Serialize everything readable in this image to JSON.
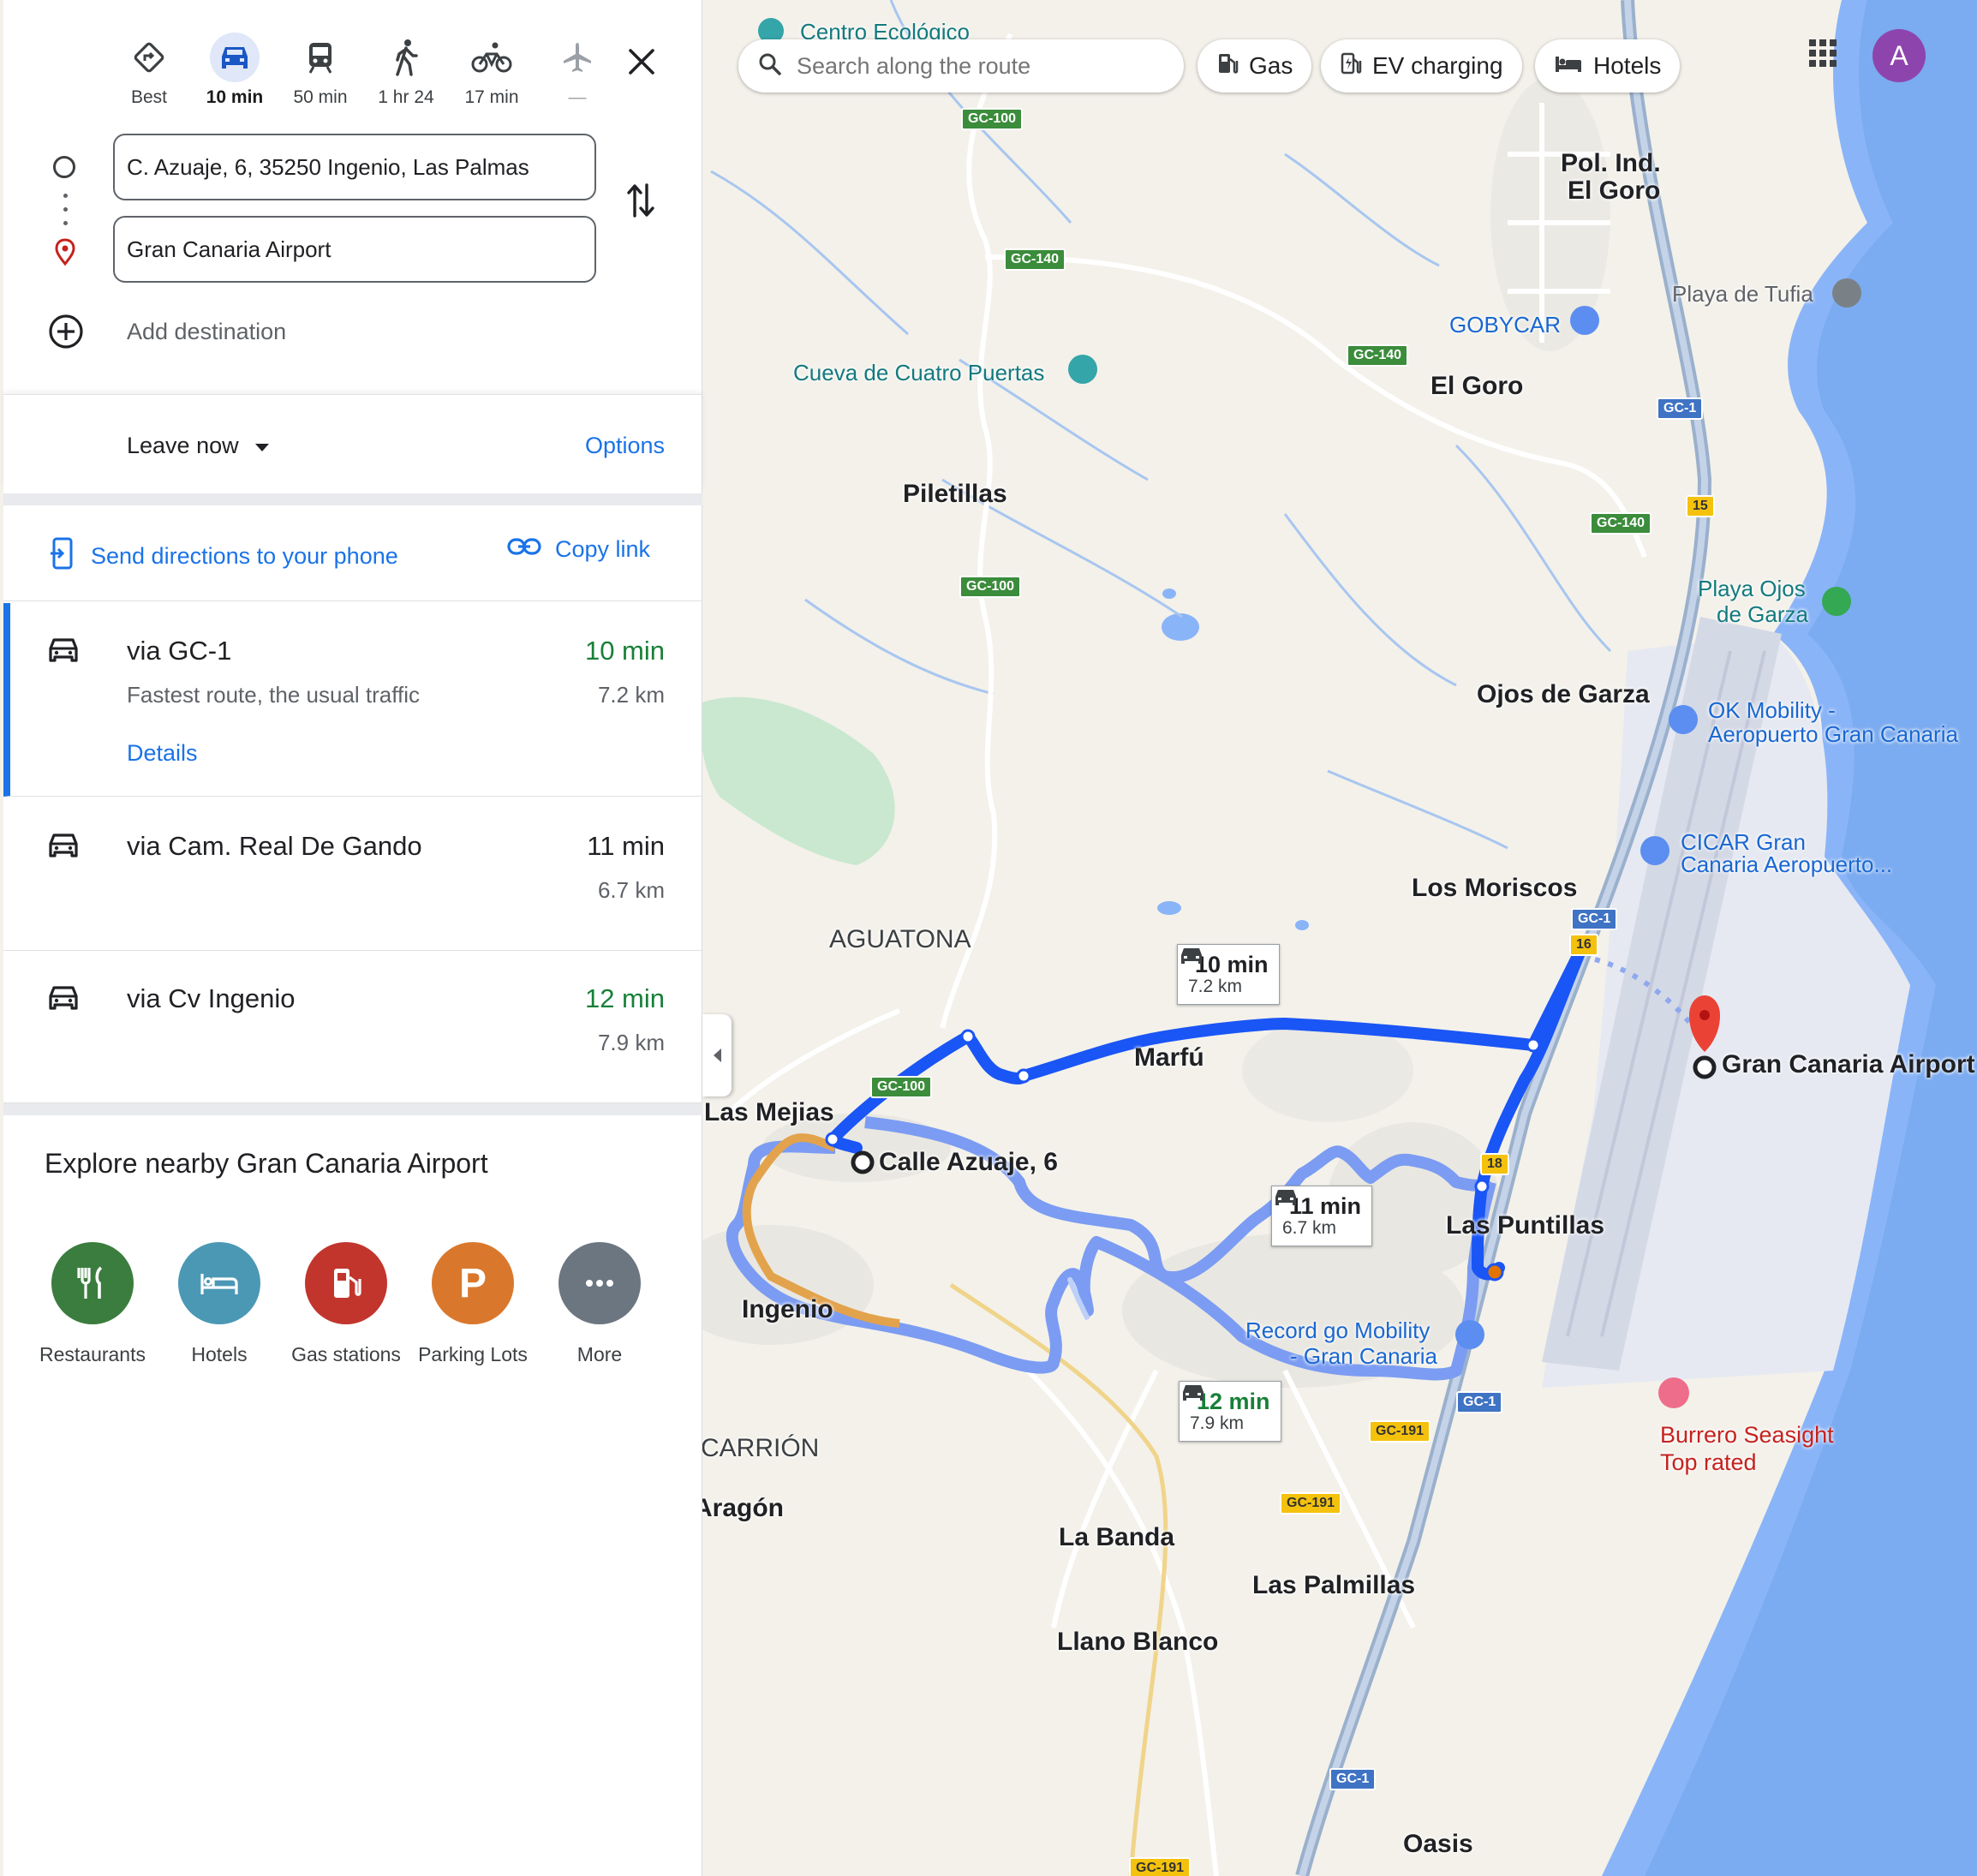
{
  "travel_modes": [
    {
      "name": "best",
      "label": "Best",
      "active": false
    },
    {
      "name": "driving",
      "label": "10 min",
      "active": true
    },
    {
      "name": "transit",
      "label": "50 min",
      "active": false
    },
    {
      "name": "walking",
      "label": "1 hr 24",
      "active": false
    },
    {
      "name": "cycling",
      "label": "17 min",
      "active": false
    },
    {
      "name": "flights",
      "label": "—",
      "active": false
    }
  ],
  "inputs": {
    "origin": "C. Azuaje, 6, 35250 Ingenio, Las Palmas",
    "destination": "Gran Canaria Airport",
    "add_destination": "Add destination"
  },
  "leave": {
    "label": "Leave now",
    "options": "Options"
  },
  "share": {
    "send_to_phone": "Send directions to your phone",
    "copy_link": "Copy link"
  },
  "routes": [
    {
      "name": "via GC-1",
      "subtitle": "Fastest route, the usual traffic",
      "time": "10 min",
      "distance": "7.2 km",
      "details": "Details",
      "time_color": "green"
    },
    {
      "name": "via Cam. Real De Gando",
      "subtitle": "",
      "time": "11 min",
      "distance": "6.7 km",
      "details": "",
      "time_color": "dark"
    },
    {
      "name": "via Cv Ingenio",
      "subtitle": "",
      "time": "12 min",
      "distance": "7.9 km",
      "details": "",
      "time_color": "green"
    }
  ],
  "explore": {
    "title": "Explore nearby Gran Canaria Airport",
    "categories": [
      {
        "name": "restaurants",
        "label": "Restaurants",
        "color": "#3b7d3e"
      },
      {
        "name": "hotels",
        "label": "Hotels",
        "color": "#4b98b5"
      },
      {
        "name": "gas-stations",
        "label": "Gas stations",
        "color": "#c2352d"
      },
      {
        "name": "parking-lots",
        "label": "Parking Lots",
        "color": "#d9782d"
      },
      {
        "name": "more",
        "label": "More",
        "color": "#6b7681"
      }
    ]
  },
  "map_search": {
    "placeholder": "Search along the route"
  },
  "chips": [
    {
      "name": "gas",
      "label": "Gas"
    },
    {
      "name": "ev-charging",
      "label": "EV charging"
    },
    {
      "name": "hotels",
      "label": "Hotels"
    }
  ],
  "account": {
    "initial": "A",
    "color": "#8e44ad"
  },
  "map": {
    "places": [
      {
        "name": "centro-ecologico",
        "label": "Centro Ecológico",
        "style": "poi-teal"
      },
      {
        "name": "pol-ind-el-goro",
        "label": "Pol. Ind.",
        "style": "place-b"
      },
      {
        "name": "pol-ind-el-goro-2",
        "label": "El Goro",
        "style": "place-b"
      },
      {
        "name": "playa-de-tufia",
        "label": "Playa de Tufia",
        "style": "poi-gray"
      },
      {
        "name": "gobycar",
        "label": "GOBYCAR",
        "style": "poi-blue"
      },
      {
        "name": "cueva-de-cuatro-puertas",
        "label": "Cueva de Cuatro Puertas",
        "style": "poi-teal"
      },
      {
        "name": "el-goro",
        "label": "El Goro",
        "style": "place-b"
      },
      {
        "name": "piletillas",
        "label": "Piletillas",
        "style": "place-b"
      },
      {
        "name": "playa-ojos-de-garza",
        "label": "Playa Ojos",
        "style": "poi-teal"
      },
      {
        "name": "playa-ojos-de-garza-2",
        "label": "de Garza",
        "style": "poi-teal"
      },
      {
        "name": "ojos-de-garza",
        "label": "Ojos de Garza",
        "style": "place-b"
      },
      {
        "name": "ok-mobility",
        "label": "OK Mobility -",
        "style": "poi-blue"
      },
      {
        "name": "ok-mobility-2",
        "label": "Aeropuerto Gran Canaria",
        "style": "poi-blue"
      },
      {
        "name": "cicar",
        "label": "CICAR Gran",
        "style": "poi-blue"
      },
      {
        "name": "cicar-2",
        "label": "Canaria Aeropuerto...",
        "style": "poi-blue"
      },
      {
        "name": "los-moriscos",
        "label": "Los Moriscos",
        "style": "place-b"
      },
      {
        "name": "aguatona",
        "label": "AGUATONA",
        "style": "place"
      },
      {
        "name": "marfu",
        "label": "Marfú",
        "style": "place-b"
      },
      {
        "name": "las-mejias",
        "label": "Las Mejias",
        "style": "place-b"
      },
      {
        "name": "calle-azuaje",
        "label": "Calle Azuaje, 6",
        "style": "place-b"
      },
      {
        "name": "gran-canaria-airport",
        "label": "Gran Canaria Airport",
        "style": "place-b"
      },
      {
        "name": "las-puntillas",
        "label": "Las Puntillas",
        "style": "place-b"
      },
      {
        "name": "ingenio",
        "label": "Ingenio",
        "style": "place-b"
      },
      {
        "name": "record-go",
        "label": "Record go Mobility",
        "style": "poi-blue"
      },
      {
        "name": "record-go-2",
        "label": "- Gran Canaria",
        "style": "poi-blue"
      },
      {
        "name": "burrero-seasight",
        "label": "Burrero Seasight",
        "style": "poi-pink"
      },
      {
        "name": "top-rated",
        "label": "Top rated",
        "style": "poi-pink"
      },
      {
        "name": "carrion",
        "label": "CARRIÓN",
        "style": "place"
      },
      {
        "name": "aragon",
        "label": "Aragón",
        "style": "place-b"
      },
      {
        "name": "la-banda",
        "label": "La Banda",
        "style": "place-b"
      },
      {
        "name": "las-palmillas",
        "label": "Las Palmillas",
        "style": "place-b"
      },
      {
        "name": "llano-blanco",
        "label": "Llano Blanco",
        "style": "place-b"
      },
      {
        "name": "oasis",
        "label": "Oasis",
        "style": "place-b"
      }
    ],
    "shields": [
      {
        "label": "GC-100",
        "style": "sh-green"
      },
      {
        "label": "GC-140",
        "style": "sh-green"
      },
      {
        "label": "GC-140",
        "style": "sh-green"
      },
      {
        "label": "GC-140",
        "style": "sh-green"
      },
      {
        "label": "GC-100",
        "style": "sh-green"
      },
      {
        "label": "GC-100",
        "style": "sh-green"
      },
      {
        "label": "GC-1",
        "style": "sh-blue"
      },
      {
        "label": "15",
        "style": "sh-yellow"
      },
      {
        "label": "GC-1",
        "style": "sh-blue"
      },
      {
        "label": "16",
        "style": "sh-yellow"
      },
      {
        "label": "18",
        "style": "sh-yellow"
      },
      {
        "label": "GC-1",
        "style": "sh-blue"
      },
      {
        "label": "GC-191",
        "style": "sh-yellow"
      },
      {
        "label": "GC-191",
        "style": "sh-yellow"
      },
      {
        "label": "GC-1",
        "style": "sh-blue"
      },
      {
        "label": "GC-191",
        "style": "sh-yellow"
      }
    ],
    "callouts": [
      {
        "time": "10 min",
        "distance": "7.2 km",
        "time_color": "#202124"
      },
      {
        "time": "11 min",
        "distance": "6.7 km",
        "time_color": "#202124"
      },
      {
        "time": "12 min",
        "distance": "7.9 km",
        "time_color": "#188038"
      }
    ]
  }
}
